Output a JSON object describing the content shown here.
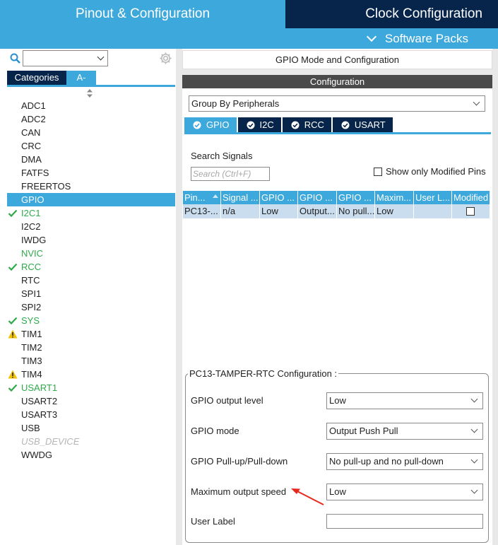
{
  "top_tabs": {
    "pinout": "Pinout & Configuration",
    "clock": "Clock Configuration",
    "software_packs": "Software Packs"
  },
  "left": {
    "search_value": "",
    "tabs": [
      "Categories",
      "A->Z"
    ],
    "peripherals": [
      {
        "label": "ADC1",
        "status": "none"
      },
      {
        "label": "ADC2",
        "status": "none"
      },
      {
        "label": "CAN",
        "status": "none"
      },
      {
        "label": "CRC",
        "status": "none"
      },
      {
        "label": "DMA",
        "status": "none"
      },
      {
        "label": "FATFS",
        "status": "none"
      },
      {
        "label": "FREERTOS",
        "status": "none"
      },
      {
        "label": "GPIO",
        "status": "selected"
      },
      {
        "label": "I2C1",
        "status": "ok"
      },
      {
        "label": "I2C2",
        "status": "none"
      },
      {
        "label": "IWDG",
        "status": "none"
      },
      {
        "label": "NVIC",
        "status": "green"
      },
      {
        "label": "RCC",
        "status": "ok"
      },
      {
        "label": "RTC",
        "status": "none"
      },
      {
        "label": "SPI1",
        "status": "none"
      },
      {
        "label": "SPI2",
        "status": "none"
      },
      {
        "label": "SYS",
        "status": "ok"
      },
      {
        "label": "TIM1",
        "status": "warn"
      },
      {
        "label": "TIM2",
        "status": "none"
      },
      {
        "label": "TIM3",
        "status": "none"
      },
      {
        "label": "TIM4",
        "status": "warn"
      },
      {
        "label": "USART1",
        "status": "ok"
      },
      {
        "label": "USART2",
        "status": "none"
      },
      {
        "label": "USART3",
        "status": "none"
      },
      {
        "label": "USB",
        "status": "none"
      },
      {
        "label": "USB_DEVICE",
        "status": "disabled"
      },
      {
        "label": "WWDG",
        "status": "none"
      }
    ]
  },
  "right": {
    "header": "GPIO Mode and Configuration",
    "config_header": "Configuration",
    "group_by": "Group By Peripherals",
    "tabs": [
      "GPIO",
      "I2C",
      "RCC",
      "USART"
    ],
    "search_label": "Search Signals",
    "search_placeholder": "Search (Ctrl+F)",
    "show_modified_label": "Show only Modified Pins",
    "table": {
      "headers": [
        "Pin...",
        "Signal ...",
        "GPIO ...",
        "GPIO ...",
        "GPIO ...",
        "Maxim...",
        "User L...",
        "Modified"
      ],
      "rows": [
        [
          "PC13-...",
          "n/a",
          "Low",
          "Output...",
          "No pull...",
          "Low",
          "",
          ""
        ]
      ]
    },
    "pin_config": {
      "title": "PC13-TAMPER-RTC Configuration :",
      "fields": [
        {
          "label": "GPIO output level",
          "value": "Low"
        },
        {
          "label": "GPIO mode",
          "value": "Output Push Pull"
        },
        {
          "label": "GPIO Pull-up/Pull-down",
          "value": "No pull-up and no pull-down"
        },
        {
          "label": "Maximum output speed",
          "value": "Low"
        },
        {
          "label": "User Label",
          "value": ""
        }
      ]
    }
  },
  "colors": {
    "accent": "#3ca8dc",
    "dark": "#07254a",
    "ok": "#2eaa4a",
    "warn": "#f2c200",
    "arrow": "#e8281e"
  }
}
